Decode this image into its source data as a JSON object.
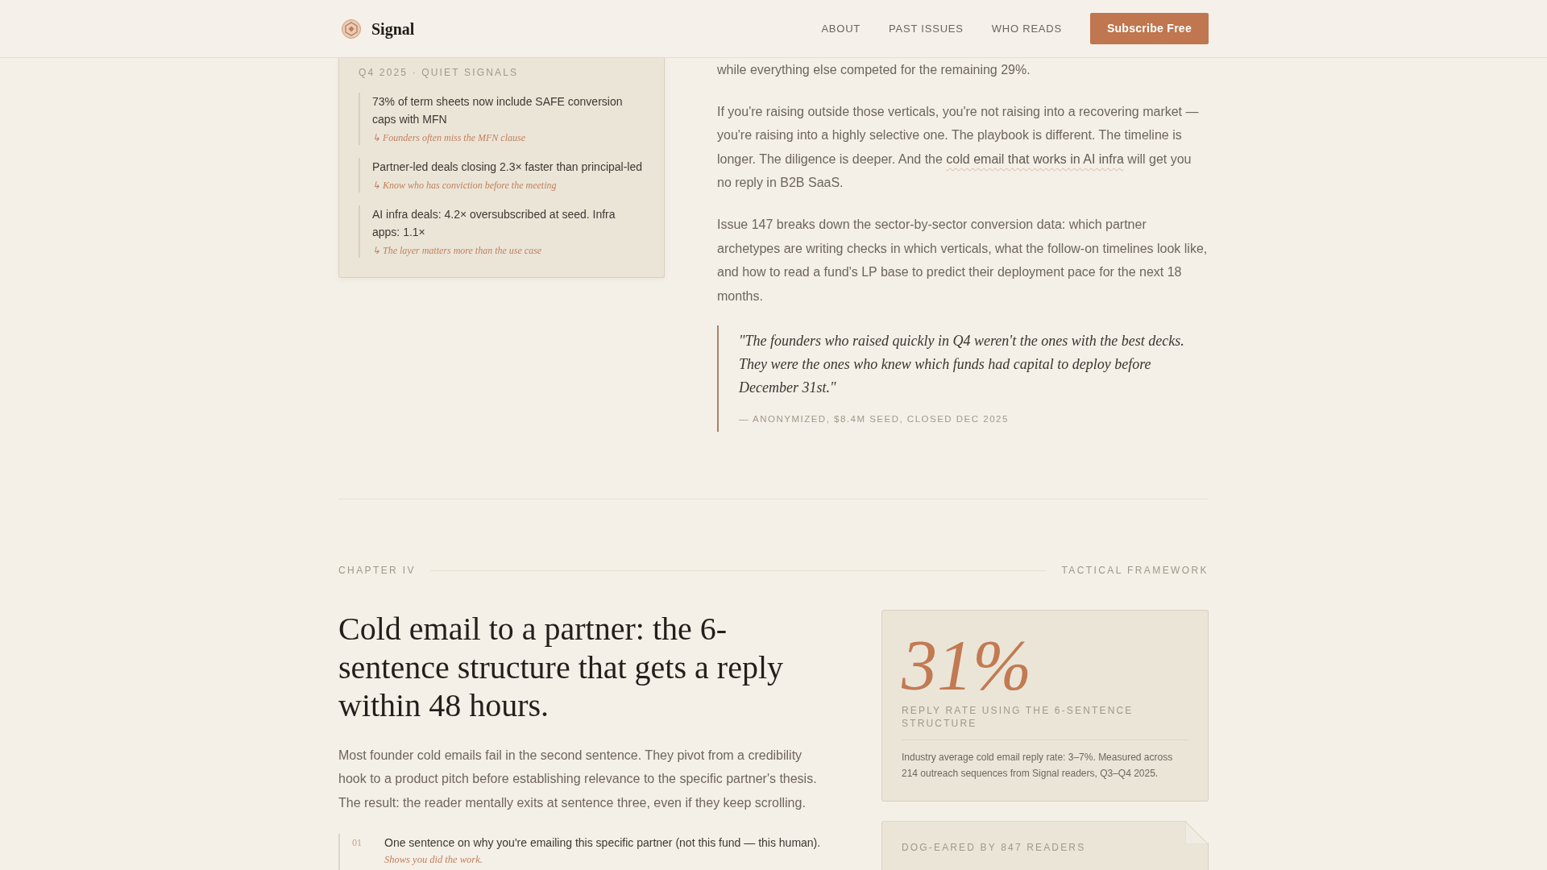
{
  "header": {
    "logo_text": "Signal",
    "nav": [
      {
        "label": "ABOUT"
      },
      {
        "label": "PAST ISSUES"
      },
      {
        "label": "WHO READS"
      }
    ],
    "cta": "Subscribe Free"
  },
  "signals_card": {
    "label": "Q4 2025 · QUIET SIGNALS",
    "items": [
      {
        "text": "73% of term sheets now include SAFE conversion caps with MFN",
        "note": "↳ Founders often miss the MFN clause"
      },
      {
        "text": "Partner-led deals closing 2.3× faster than principal-led",
        "note": "↳ Know who has conviction before the meeting"
      },
      {
        "text": "AI infra deals: 4.2× oversubscribed at seed. Infra apps: 1.1×",
        "note": "↳ The layer matters more than the use case"
      }
    ]
  },
  "article": {
    "paragraphs": [
      {
        "text": "while everything else competed for the remaining 29%."
      },
      {
        "text": "If you're raising outside those verticals, you're not raising into a recovering market — you're raising into a highly selective one. The playbook is different. The timeline is longer. The diligence is deeper. And the ",
        "link": "cold email that works in AI infra",
        "after": " will get you no reply in B2B SaaS."
      },
      {
        "text": "Issue 147 breaks down the sector-by-sector conversion data: which partner archetypes are writing checks in which verticals, what the follow-on timelines look like, and how to read a fund's LP base to predict their deployment pace for the next 18 months."
      }
    ],
    "quote": {
      "text": "\"The founders who raised quickly in Q4 weren't the ones with the best decks. They were the ones who knew which funds had capital to deploy before December 31st.\"",
      "attribution": "— ANONYMIZED, $8.4M SEED, CLOSED DEC 2025"
    }
  },
  "chapter": {
    "label": "CHAPTER IV",
    "tag": "TACTICAL FRAMEWORK",
    "title": "Cold email to a partner: the 6-sentence structure that gets a reply within 48 hours.",
    "intro": "Most founder cold emails fail in the second sentence. They pivot from a credibility hook to a product pitch before establishing relevance to the specific partner's thesis. The result: the reader mentally exits at sentence three, even if they keep scrolling.",
    "steps": [
      {
        "number": "01",
        "text": "One sentence on why you're emailing this specific partner (not this fund — this human).",
        "note": "Shows you did the work."
      }
    ]
  },
  "stat_card": {
    "value": "31%",
    "label": "REPLY RATE USING THE 6-SENTENCE STRUCTURE",
    "detail": "Industry average cold email reply rate: 3–7%. Measured across 214 outreach sequences from Signal readers, Q3–Q4 2025."
  },
  "dog_eared_card": {
    "label": "DOG-EARED BY 847 READERS"
  }
}
